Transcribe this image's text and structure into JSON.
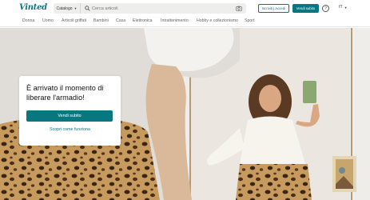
{
  "brand": {
    "name": "Vinted",
    "accent": "#09777f"
  },
  "search": {
    "category_label": "Catalogo",
    "placeholder": "Cerca articoli"
  },
  "header": {
    "login_label": "Iscriviti | Accedi",
    "sell_label": "Vendi subito",
    "help_symbol": "?",
    "language": "IT"
  },
  "nav": {
    "items": [
      "Donna",
      "Uomo",
      "Articoli griffati",
      "Bambini",
      "Casa",
      "Elettronica",
      "Intrattenimento",
      "Hobby e collezionismo",
      "Sport"
    ]
  },
  "hero": {
    "title": "È arrivato il momento di liberare l'armadio!",
    "cta_label": "Vendi subito",
    "link_label": "Scopri come funziona"
  },
  "icons": {
    "search": "search-icon",
    "camera": "camera-icon",
    "help": "help-icon",
    "chevron": "chevron-down-icon"
  }
}
